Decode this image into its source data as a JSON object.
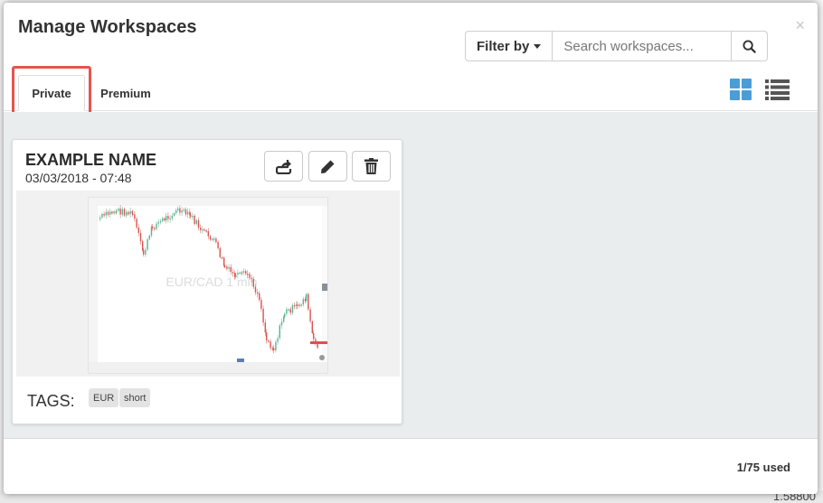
{
  "modal": {
    "title": "Manage Workspaces",
    "close_glyph": "×"
  },
  "search": {
    "filter_label": "Filter by",
    "placeholder": "Search workspaces...",
    "value": ""
  },
  "tabs": [
    {
      "label": "Private",
      "active": true
    },
    {
      "label": "Premium",
      "active": false
    }
  ],
  "view_toggle": {
    "grid_icon": "grid-view-icon",
    "list_icon": "list-view-icon",
    "active": "grid"
  },
  "workspace_card": {
    "name": "EXAMPLE NAME",
    "date": "03/03/2018 - 07:48",
    "actions": [
      "share-icon",
      "pencil-icon",
      "trash-icon"
    ],
    "thumbnail_watermark": "EUR/CAD 1 min",
    "tags_label": "TAGS:",
    "tags": [
      "EUR",
      "short"
    ]
  },
  "footer": {
    "usage": "1/75 used"
  },
  "colors": {
    "accent": "#4a9ed8",
    "highlight": "#e5554f",
    "candle_up": "#59b38f",
    "candle_down": "#d9534f",
    "content_bg": "#e9eded"
  },
  "background": {
    "price_label": "1.58800"
  }
}
